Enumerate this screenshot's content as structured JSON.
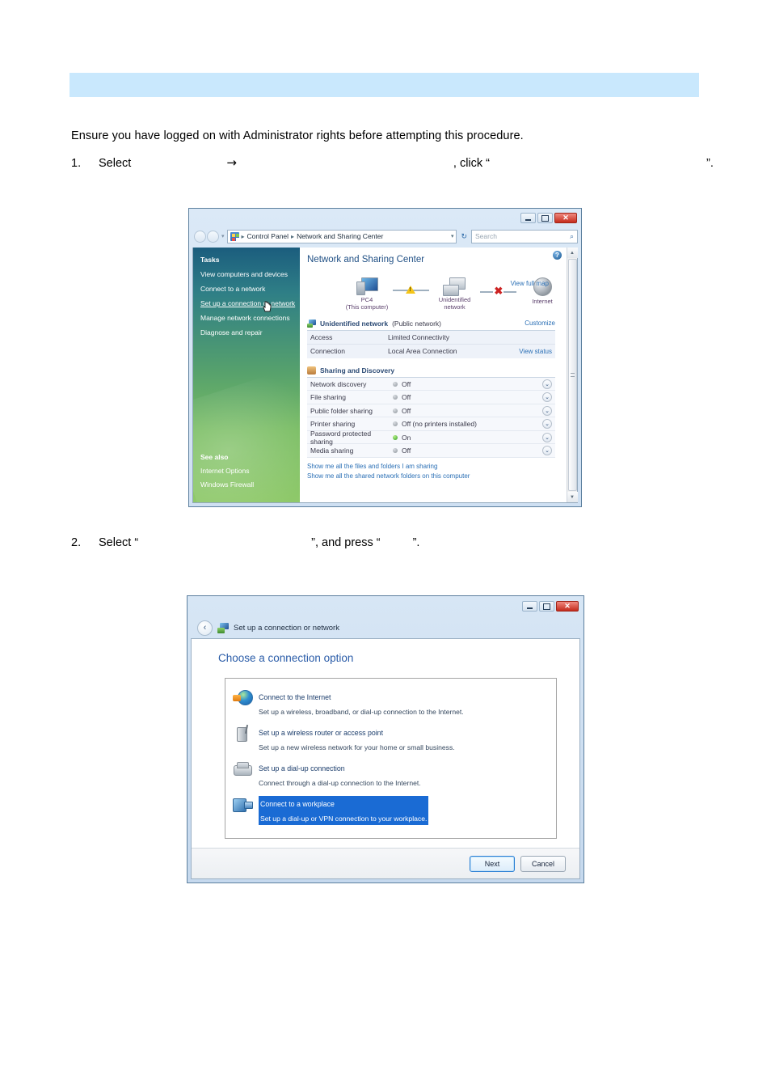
{
  "document": {
    "intro": "Ensure you have logged on with Administrator rights before attempting this procedure.",
    "steps": [
      {
        "number": "1.",
        "seg1": "Select",
        "arrow": "→",
        "seg2": ", click “",
        "seg3": "”."
      },
      {
        "number": "2.",
        "seg1": "Select “",
        "seg2": "”, and press “",
        "seg3": "”."
      }
    ],
    "header_band_color": "#c9e8fd"
  },
  "screenshot1": {
    "name": "Network and Sharing Center",
    "window_controls": {
      "minimize": "–",
      "maximize": "□",
      "close": "✕"
    },
    "address_bar": {
      "back_label": "Back",
      "forward_label": "Forward",
      "breadcrumb": [
        "Control Panel",
        "Network and Sharing Center"
      ],
      "separator": "▸",
      "dropdown": "▾",
      "refresh": "↻",
      "search_placeholder": "Search",
      "search_icon": "⌕"
    },
    "sidebar": {
      "tasks_heading": "Tasks",
      "tasks": [
        "View computers and devices",
        "Connect to a network",
        "Set up a connection or network",
        "Manage network connections",
        "Diagnose and repair"
      ],
      "active_task": "Set up a connection or network",
      "see_also_heading": "See also",
      "see_also": [
        "Internet Options",
        "Windows Firewall"
      ],
      "cursor": "Ὓ0"
    },
    "content": {
      "help_icon": "?",
      "title": "Network and Sharing Center",
      "view_full_map": "View full map",
      "map": {
        "nodes": [
          {
            "label": "PC4",
            "sublabel": "(This computer)",
            "icon": "computer-icon"
          },
          {
            "label": "Unidentified network",
            "sublabel": "",
            "icon": "network-icon"
          },
          {
            "label": "Internet",
            "sublabel": "",
            "icon": "globe-icon"
          }
        ],
        "link1_status": "warning",
        "link2_status": "error",
        "error_mark": "✖"
      },
      "network_section": {
        "title": "Unidentified network",
        "subtitle": "(Public network)",
        "customize": "Customize",
        "rows": [
          {
            "key": "Access",
            "value": "Limited Connectivity",
            "action": ""
          },
          {
            "key": "Connection",
            "value": "Local Area Connection",
            "action": "View status"
          }
        ]
      },
      "sharing_section": {
        "title": "Sharing and Discovery",
        "rows": [
          {
            "key": "Network discovery",
            "state": "off",
            "value": "Off"
          },
          {
            "key": "File sharing",
            "state": "off",
            "value": "Off"
          },
          {
            "key": "Public folder sharing",
            "state": "off",
            "value": "Off"
          },
          {
            "key": "Printer sharing",
            "state": "off",
            "value": "Off (no printers installed)"
          },
          {
            "key": "Password protected sharing",
            "state": "on",
            "value": "On"
          },
          {
            "key": "Media sharing",
            "state": "off",
            "value": "Off"
          }
        ],
        "expand_icon": "⌄"
      },
      "footer_links": [
        "Show me all the files and folders I am sharing",
        "Show me all the shared network folders on this computer"
      ]
    },
    "scrollbar": {
      "up": "▲",
      "down": "▼"
    }
  },
  "screenshot2": {
    "name": "Set up a connection or network",
    "window_controls": {
      "minimize": "–",
      "maximize": "□",
      "close": "✕"
    },
    "back_arrow": "‹",
    "title": "Set up a connection or network",
    "heading": "Choose a connection option",
    "options": [
      {
        "title": "Connect to the Internet",
        "desc": "Set up a wireless, broadband, or dial-up connection to the Internet.",
        "icon": "globe-icon",
        "selected": false
      },
      {
        "title": "Set up a wireless router or access point",
        "desc": "Set up a new wireless network for your home or small business.",
        "icon": "router-icon",
        "selected": false
      },
      {
        "title": "Set up a dial-up connection",
        "desc": "Connect through a dial-up connection to the Internet.",
        "icon": "modem-icon",
        "selected": false
      },
      {
        "title": "Connect to a workplace",
        "desc": "Set up a dial-up or VPN connection to your workplace.",
        "icon": "workplace-icon",
        "selected": true
      }
    ],
    "buttons": {
      "next": "Next",
      "cancel": "Cancel"
    },
    "selection_color": "#1a6bd4"
  }
}
